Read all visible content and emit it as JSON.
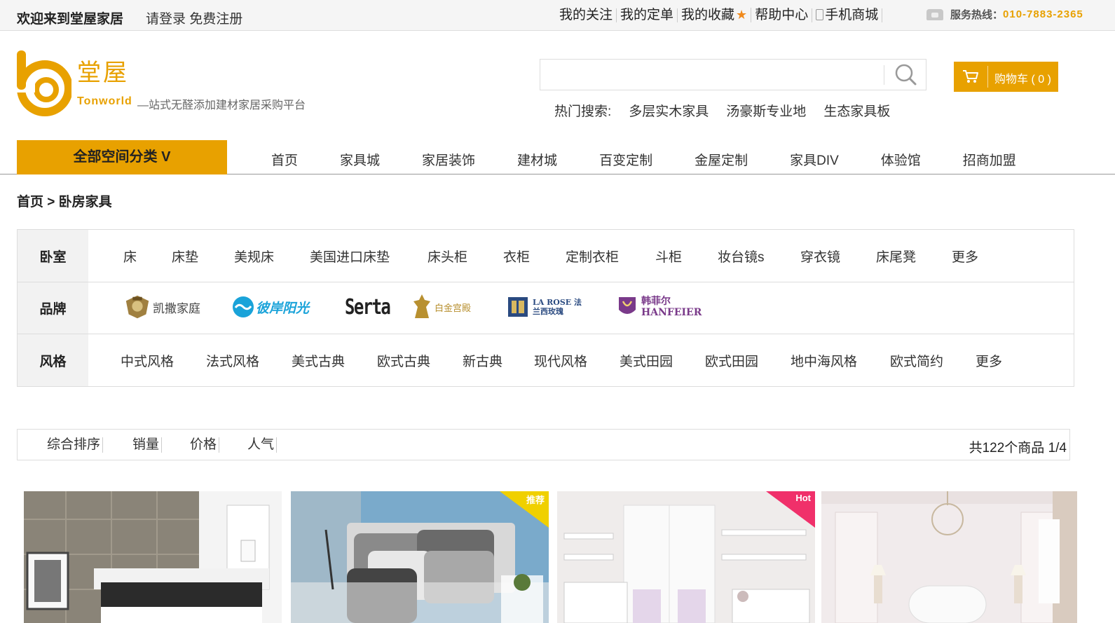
{
  "topbar": {
    "welcome": "欢迎来到堂屋家居",
    "login": "请登录",
    "register": "免费注册",
    "links": [
      "我的关注",
      "我的定单",
      "我的收藏",
      "帮助中心",
      "手机商城"
    ],
    "hotline_label": "服务热线：",
    "hotline_number": "010-7883-2365"
  },
  "header": {
    "logo_name": "堂屋",
    "logo_en": "Tonworld",
    "slogan": "—站式无醛添加建材家居采购平台",
    "search_value": "",
    "hot_label": "热门搜索:",
    "hot_keywords": [
      "多层实木家具",
      "汤豪斯专业地",
      "生态家具板"
    ],
    "cart_label": "购物车 ( 0 )",
    "accent_color": "#e8a100"
  },
  "nav": {
    "all_categories": "全部空间分类 V",
    "items": [
      "首页",
      "家具城",
      "家居装饰",
      "建材城",
      "百变定制",
      "金屋定制",
      "家具DIV",
      "体验馆",
      "招商加盟"
    ]
  },
  "breadcrumb": {
    "home": "首页",
    "sep": " > ",
    "current": "卧房家具"
  },
  "filters": {
    "bedroom": {
      "label": "卧室",
      "items": [
        "床",
        "床垫",
        "美规床",
        "美国进口床垫",
        "床头柜",
        "衣柜",
        "定制衣柜",
        "斗柜",
        "妆台镜s",
        "穿衣镜",
        "床尾凳",
        "更多"
      ]
    },
    "brand": {
      "label": "品牌",
      "items": [
        "凯撒家庭",
        "彼岸阳光",
        "Serta",
        "白金宫殿",
        "LA ROSE 法兰西玫瑰",
        "韩菲尔 HANFEIER"
      ]
    },
    "style": {
      "label": "风格",
      "items": [
        "中式风格",
        "法式风格",
        "美式古典",
        "欧式古典",
        "新古典",
        "现代风格",
        "美式田园",
        "欧式田园",
        "地中海风格",
        "欧式简约",
        "更多"
      ]
    }
  },
  "sortbar": {
    "items": [
      "综合排序",
      "销量",
      "价格",
      "人气"
    ],
    "count": "共122个商品 1/4"
  },
  "products": [
    {
      "badge": ""
    },
    {
      "badge": "推荐"
    },
    {
      "badge": "Hot"
    },
    {
      "badge": ""
    }
  ]
}
